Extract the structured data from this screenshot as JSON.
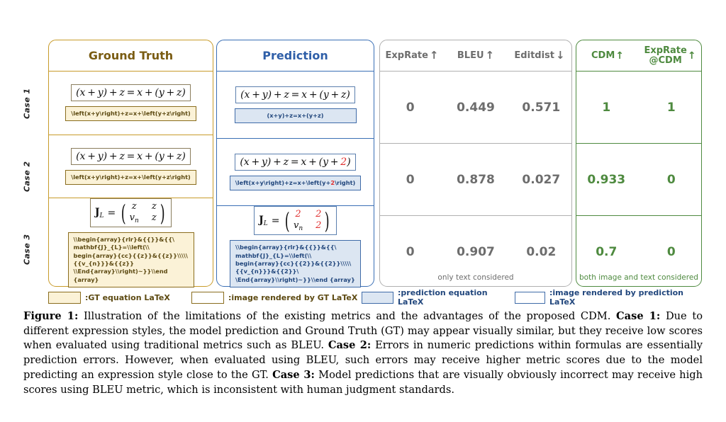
{
  "figure": {
    "case_labels": [
      "Case 1",
      "Case 2",
      "Case 3"
    ],
    "panels": {
      "ground_truth": {
        "title": "Ground Truth",
        "border_color": "#c89b2a",
        "rows": [
          {
            "rendered_equation": "(x + y) + z = x + (y + z)",
            "latex": "\\left(x+y\\right)+z=x+\\left(y+z\\right)"
          },
          {
            "rendered_equation": "(x + y) + z = x + (y + z)",
            "latex": "\\left(x+y\\right)+z=x+\\left(y+z\\right)"
          },
          {
            "rendered_equation": "J_L = matrix(z z; v_n z)",
            "matrix": {
              "lhs": "J",
              "lhs_sub": "L",
              "cells": [
                "z",
                "z",
                "v_n",
                "z"
              ]
            },
            "latex": "\\\\begin{array}{rlr}&{{}}&{{\\\nmathbf{J}_{L}=\\\\left(\\\\\nbegin{array}{cc}{{z}}&{{z}}\\\\\\\\\\{{v_{n}}}&{{z}}\n\\\\End{array}\\\\right)~}}\\\\end {array}"
          }
        ]
      },
      "prediction": {
        "title": "Prediction",
        "border_color": "#3a6fb5",
        "rows": [
          {
            "rendered_equation": "(x + y) + z = x + (y + z)",
            "latex": "(x+y)+z=x+(y+z)"
          },
          {
            "rendered_equation": "(x + y) + z = x + (y + 2)",
            "rendered_error_token": "2",
            "latex_prefix": "\\left(x+y\\right)+z=x+\\left(y+",
            "latex_error_token": "2",
            "latex_suffix": "\\right)"
          },
          {
            "rendered_equation": "J_L = matrix(2 2; v_n 2)",
            "matrix": {
              "lhs": "J",
              "lhs_sub": "L",
              "cells": [
                "2",
                "2",
                "v_n",
                "2"
              ]
            },
            "latex": "\\\\begin{array}{rlr}&{{}}&{{\\\nmathbf{J}_{L}=\\\\left(\\\\\nbegin{array}{cc}{{2}}&{{2}}\\\\\\\\\\{{v_{n}}}&{{2}}\\\n\\End{array}\\\\right)~}}\\\\end {array}"
          }
        ]
      },
      "metrics": {
        "border_color": "#b0b0b0",
        "columns": [
          {
            "label": "ExpRate",
            "arrow": "up"
          },
          {
            "label": "BLEU",
            "arrow": "up"
          },
          {
            "label": "Editdist",
            "arrow": "down"
          }
        ],
        "rows": [
          [
            "0",
            "0.449",
            "0.571"
          ],
          [
            "0",
            "0.878",
            "0.027"
          ],
          [
            "0",
            "0.907",
            "0.02"
          ]
        ],
        "footnote": "only text considered"
      },
      "cdm": {
        "border_color": "#4e8a3f",
        "columns": [
          {
            "label": "CDM",
            "arrow": "up"
          },
          {
            "label": "ExpRate",
            "label2": "@CDM",
            "arrow": "up"
          }
        ],
        "rows": [
          [
            "1",
            "1"
          ],
          [
            "0.933",
            "0"
          ],
          [
            "0.7",
            "0"
          ]
        ],
        "footnote": "both image and text considered"
      }
    },
    "legend": [
      {
        "swatch": "gt-latex",
        "text": ":GT equation LaTeX"
      },
      {
        "swatch": "gt-image",
        "text": ":image rendered by GT LaTeX"
      },
      {
        "swatch": "pred-latex",
        "text": ":prediction equation LaTeX"
      },
      {
        "swatch": "pred-image",
        "text": ":image rendered by prediction LaTeX"
      }
    ]
  },
  "caption": {
    "label": "Figure 1:",
    "part1": " Illustration of the limitations of the existing metrics and the advantages of the proposed CDM. ",
    "case1_label": "Case 1:",
    "part2": " Due to different expression styles, the model prediction and Ground Truth (GT) may appear visually similar, but they receive low scores when evaluated using traditional metrics such as BLEU. ",
    "case2_label": "Case 2:",
    "part3": " Errors in numeric predictions within formulas are essentially prediction errors. However, when evaluated using BLEU, such errors may receive higher metric scores due to the model predicting an expression style close to the GT. ",
    "case3_label": "Case 3:",
    "part4": " Model predictions that are visually obviously incorrect may receive high scores using BLEU metric, which is inconsistent with human judgment standards."
  }
}
